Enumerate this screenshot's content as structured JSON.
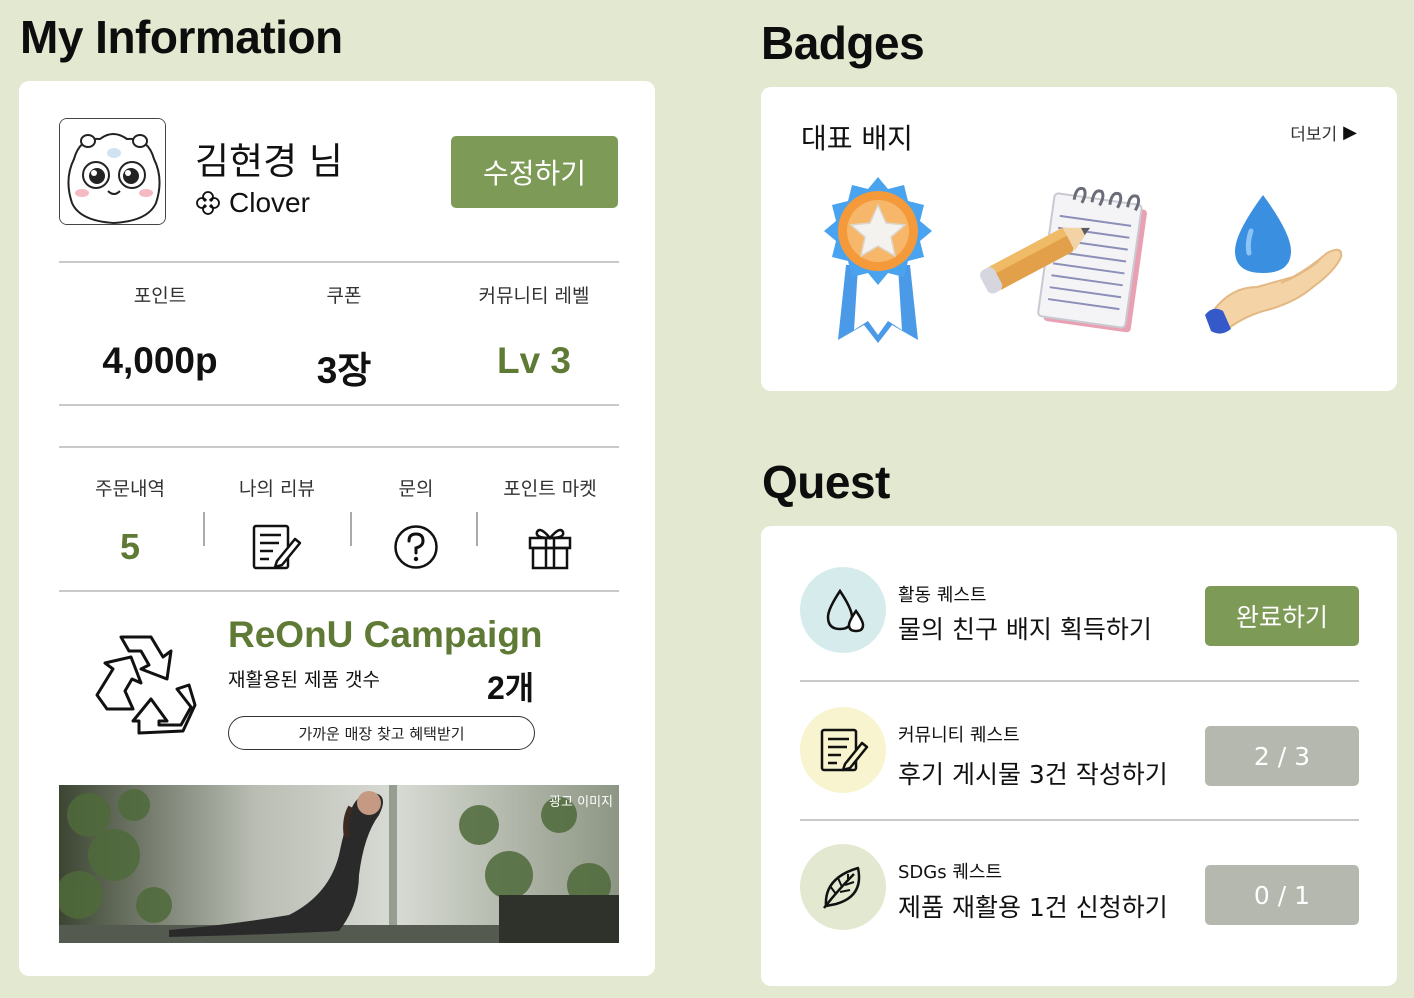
{
  "sections": {
    "my_information": "My Information",
    "badges": "Badges",
    "quest": "Quest"
  },
  "profile": {
    "name": "김현경 님",
    "grade": "Clover",
    "grade_icon": "clover-icon",
    "avatar_icon": "hamster-avatar",
    "edit_label": "수정하기"
  },
  "stats": [
    {
      "label": "포인트",
      "value": "4,000p"
    },
    {
      "label": "쿠폰",
      "value": "3장"
    },
    {
      "label": "커뮤니티 레벨",
      "value": "Lv 3"
    }
  ],
  "menu": [
    {
      "label": "주문내역",
      "value": "5"
    },
    {
      "label": "나의 리뷰",
      "icon": "review-icon"
    },
    {
      "label": "문의",
      "icon": "question-icon"
    },
    {
      "label": "포인트 마켓",
      "icon": "gift-icon"
    }
  ],
  "campaign": {
    "title": "ReOnU Campaign",
    "label": "재활용된 제품 갯수",
    "count": "2개",
    "button": "가까운 매장 찾고 혜택받기"
  },
  "ad": {
    "label": "광고 이미지"
  },
  "badges": {
    "heading": "대표 배지",
    "more": "더보기",
    "items": [
      "star-medal-badge",
      "notebook-pencil-badge",
      "water-drop-hand-badge"
    ]
  },
  "quests": [
    {
      "category": "활동 퀘스트",
      "title": "물의 친구 배지 획득하기",
      "action": "완료하기",
      "state": "completable",
      "icon": "water-drops-icon"
    },
    {
      "category": "커뮤니티 퀘스트",
      "title": "후기 게시물 3건 작성하기",
      "action": "2 / 3",
      "state": "progress",
      "icon": "review-icon"
    },
    {
      "category": "SDGs 퀘스트",
      "title": "제품 재활용 1건 신청하기",
      "action": "0 / 1",
      "state": "progress",
      "icon": "leaf-icon"
    }
  ],
  "colors": {
    "background": "#e3e9d0",
    "accent_green": "#7e9a57",
    "level_green": "#5e7a35",
    "disabled_gray": "#b5b8ae",
    "quest_blue": "#d6ecec",
    "quest_yellow": "#f7f4cf",
    "quest_sage": "#e3e9d0"
  }
}
